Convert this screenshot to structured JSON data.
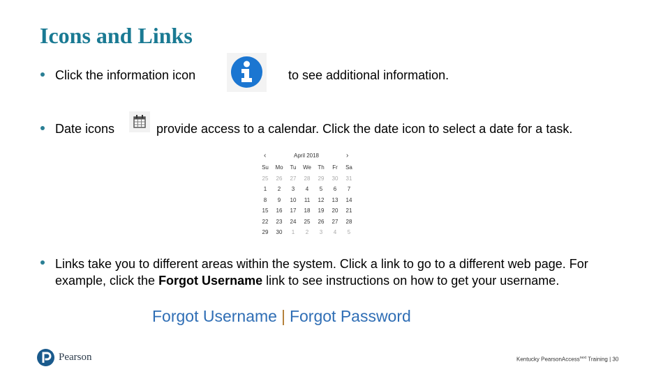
{
  "title": "Icons and Links",
  "bullets": {
    "info_before": "Click the information icon",
    "info_after": "to see additional information.",
    "date_before": "Date icons",
    "date_after": "provide access to a calendar. Click the date icon to select a date for a task.",
    "links_line1": "Links take you to different areas within the system. Click a link to go to a different web page. For",
    "links_line2_pre": "example, click the ",
    "links_line2_bold": "Forgot Username",
    "links_line2_post": " link to see instructions on how to get your username."
  },
  "icons": {
    "info": "info-icon",
    "date": "calendar-icon"
  },
  "calendar": {
    "month_label": "April 2018",
    "prev": "‹",
    "next": "›",
    "weekdays": [
      "Su",
      "Mo",
      "Tu",
      "We",
      "Th",
      "Fr",
      "Sa"
    ],
    "weeks": [
      [
        [
          "25",
          true
        ],
        [
          "26",
          true
        ],
        [
          "27",
          true
        ],
        [
          "28",
          true
        ],
        [
          "29",
          true
        ],
        [
          "30",
          true
        ],
        [
          "31",
          true
        ]
      ],
      [
        [
          "1",
          false
        ],
        [
          "2",
          false
        ],
        [
          "3",
          false
        ],
        [
          "4",
          false
        ],
        [
          "5",
          false
        ],
        [
          "6",
          false
        ],
        [
          "7",
          false
        ]
      ],
      [
        [
          "8",
          false
        ],
        [
          "9",
          false
        ],
        [
          "10",
          false
        ],
        [
          "11",
          false
        ],
        [
          "12",
          false
        ],
        [
          "13",
          false
        ],
        [
          "14",
          false
        ]
      ],
      [
        [
          "15",
          false
        ],
        [
          "16",
          false
        ],
        [
          "17",
          false
        ],
        [
          "18",
          false
        ],
        [
          "19",
          false
        ],
        [
          "20",
          false
        ],
        [
          "21",
          false
        ]
      ],
      [
        [
          "22",
          false
        ],
        [
          "23",
          false
        ],
        [
          "24",
          false
        ],
        [
          "25",
          false
        ],
        [
          "26",
          false
        ],
        [
          "27",
          false
        ],
        [
          "28",
          false
        ]
      ],
      [
        [
          "29",
          false
        ],
        [
          "30",
          false
        ],
        [
          "1",
          true
        ],
        [
          "2",
          true
        ],
        [
          "3",
          true
        ],
        [
          "4",
          true
        ],
        [
          "5",
          true
        ]
      ]
    ]
  },
  "links": {
    "forgot_username": "Forgot Username",
    "separator": "|",
    "forgot_password": "Forgot Password"
  },
  "brand": {
    "logo_letter": "P",
    "name": "Pearson"
  },
  "footer": {
    "text": "Kentucky PearsonAccess",
    "superscript": "next",
    "suffix": " Training",
    "separator": "|",
    "page": "30"
  },
  "colors": {
    "title": "#1a7a93",
    "info_icon": "#1b76d1",
    "link": "#2f6eb5"
  }
}
